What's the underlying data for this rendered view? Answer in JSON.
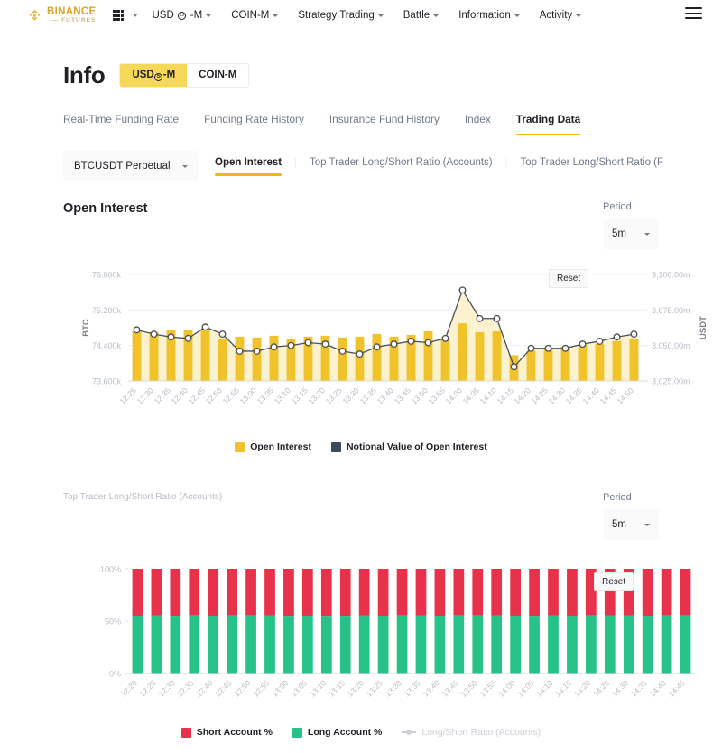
{
  "topnav": {
    "logo": {
      "brand": "BINANCE",
      "sub": "— FUTURES",
      "icon": "binance-diamond-icon"
    },
    "apps_icon": "grid-apps-icon",
    "items": [
      {
        "label": "USD",
        "mid": "S",
        "tail": "-M",
        "caret": true
      },
      {
        "label": "COIN-M",
        "caret": true
      },
      {
        "label": "Strategy Trading",
        "caret": true
      },
      {
        "label": "Battle",
        "caret": true
      },
      {
        "label": "Information",
        "caret": true
      },
      {
        "label": "Activity",
        "caret": true
      }
    ],
    "menu_icon": "hamburger-menu-icon"
  },
  "header": {
    "title": "Info",
    "segments": [
      {
        "label": "USD",
        "mid": "S",
        "tail": "-M",
        "active": true
      },
      {
        "label": "COIN-M",
        "active": false
      }
    ]
  },
  "main_tabs": [
    {
      "label": "Real-Time Funding Rate",
      "active": false
    },
    {
      "label": "Funding Rate History",
      "active": false
    },
    {
      "label": "Insurance Fund History",
      "active": false
    },
    {
      "label": "Index",
      "active": false
    },
    {
      "label": "Trading Data",
      "active": true
    }
  ],
  "symbol_select": {
    "value": "BTCUSDT Perpetual",
    "caret": "chevron-down-icon"
  },
  "sub_tabs": [
    {
      "label": "Open Interest",
      "active": true
    },
    {
      "label": "Top Trader Long/Short Ratio (Accounts)",
      "active": false
    },
    {
      "label": "Top Trader Long/Short Ratio (F",
      "active": false
    }
  ],
  "open_interest": {
    "title": "Open Interest",
    "period_label": "Period",
    "period_value": "5m",
    "reset_label": "Reset",
    "legend": [
      {
        "label": "Open Interest",
        "color": "#f0c22c",
        "type": "swatch"
      },
      {
        "label": "Notional Value of Open Interest",
        "color": "#3c4a5a",
        "type": "swatch"
      }
    ]
  },
  "long_short": {
    "title": "Top Trader Long/Short Ratio (Accounts)",
    "period_label": "Period",
    "period_value": "5m",
    "reset_label": "Reset",
    "legend": [
      {
        "label": "Short Account %",
        "color": "#e8314a",
        "type": "swatch"
      },
      {
        "label": "Long Account %",
        "color": "#27c histories",
        "type": "swatch"
      },
      {
        "label": "Long/Short Ratio (Accounts)",
        "color": "#ccd0d6",
        "type": "line",
        "disabled": true
      }
    ]
  },
  "colors": {
    "brand_yellow": "#f0b90b",
    "bar_yellow": "#f0c22c",
    "area_yellow": "#fbeec0",
    "line_dark": "#4a4f57",
    "green": "#27c28a",
    "red": "#e8314a",
    "grid": "#f0f1f2",
    "axis_text": "#b7bdc6"
  },
  "chart_data": [
    {
      "type": "bar",
      "id": "open-interest",
      "title": "Open Interest",
      "xlabel": "",
      "ylabel": "BTC",
      "y2label": "USDT",
      "ylim": [
        73600,
        76000
      ],
      "yticks": [
        73600,
        74400,
        75200,
        76000
      ],
      "ytick_labels": [
        "73.600k",
        "74.400k",
        "75.200k",
        "76.000k"
      ],
      "y2lim": [
        3025,
        3100
      ],
      "y2ticks": [
        3025,
        3050,
        3075,
        3100
      ],
      "y2tick_labels": [
        "3,025.00m",
        "3,050.00m",
        "3,075.00m",
        "3,100.00m"
      ],
      "grid": true,
      "legend_position": "bottom",
      "categories": [
        "12:25",
        "12:30",
        "12:35",
        "12:40",
        "12:45",
        "12:50",
        "12:55",
        "13:00",
        "13:05",
        "13:10",
        "13:15",
        "13:20",
        "13:25",
        "13:30",
        "13:35",
        "13:40",
        "13:45",
        "13:50",
        "13:55",
        "14:00",
        "14:05",
        "14:10",
        "14:15",
        "14:20",
        "14:25",
        "14:30",
        "14:35",
        "14:40",
        "14:45",
        "14:50"
      ],
      "series": [
        {
          "name": "Open Interest",
          "render": "bar",
          "axis": "left",
          "values": [
            74720,
            74700,
            74740,
            74740,
            74740,
            74560,
            74600,
            74580,
            74620,
            74540,
            74600,
            74620,
            74580,
            74600,
            74660,
            74600,
            74640,
            74720,
            74560,
            74900,
            74700,
            74720,
            74180,
            74280,
            74320,
            74380,
            74420,
            74440,
            74500,
            74560
          ]
        },
        {
          "name": "Notional Value of Open Interest",
          "render": "line-area",
          "axis": "right",
          "values": [
            3061,
            3058,
            3056,
            3055,
            3063,
            3058,
            3046,
            3046,
            3049,
            3050,
            3052,
            3051,
            3046,
            3044,
            3049,
            3051,
            3053,
            3052,
            3055,
            3089,
            3069,
            3069,
            3035,
            3048,
            3048,
            3048,
            3051,
            3053,
            3056,
            3058
          ]
        }
      ]
    },
    {
      "type": "bar",
      "id": "long-short-ratio",
      "title": "Top Trader Long/Short Ratio (Accounts)",
      "stacked": true,
      "xlabel": "",
      "ylabel": "",
      "ylim": [
        0,
        100
      ],
      "yticks": [
        0,
        50,
        100
      ],
      "ytick_labels": [
        "0%",
        "50%",
        "100%"
      ],
      "grid": false,
      "legend_position": "bottom",
      "categories": [
        "12:20",
        "12:25",
        "12:30",
        "12:35",
        "12:40",
        "12:45",
        "12:50",
        "12:55",
        "13:00",
        "13:05",
        "13:10",
        "13:15",
        "13:20",
        "13:25",
        "13:30",
        "13:35",
        "13:40",
        "13:45",
        "13:50",
        "13:55",
        "14:00",
        "14:05",
        "14:10",
        "14:15",
        "14:20",
        "14:25",
        "14:30",
        "14:35",
        "14:40",
        "14:45"
      ],
      "series": [
        {
          "name": "Long Account %",
          "color": "#27c28a",
          "values": [
            55.2,
            55.3,
            55.1,
            55.4,
            55.2,
            55.5,
            55.4,
            55.3,
            55.1,
            55.2,
            55.0,
            55.1,
            55.3,
            55.2,
            55.4,
            55.3,
            55.2,
            55.4,
            55.5,
            55.3,
            55.2,
            55.1,
            55.3,
            55.2,
            55.4,
            55.6,
            55.3,
            55.2,
            55.4,
            55.5
          ]
        },
        {
          "name": "Short Account %",
          "color": "#e8314a",
          "values": [
            44.8,
            44.7,
            44.9,
            44.6,
            44.8,
            44.5,
            44.6,
            44.7,
            44.9,
            44.8,
            45.0,
            44.9,
            44.7,
            44.8,
            44.6,
            44.7,
            44.8,
            44.6,
            44.5,
            44.7,
            44.8,
            44.9,
            44.7,
            44.8,
            44.6,
            44.4,
            44.7,
            44.8,
            44.6,
            44.5
          ]
        }
      ]
    }
  ]
}
